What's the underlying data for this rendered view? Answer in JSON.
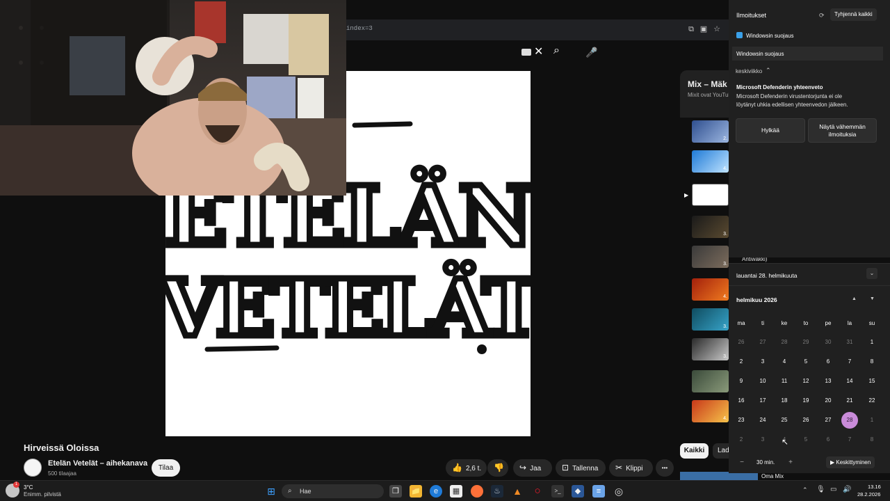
{
  "browser": {
    "url_fragment": "index=3"
  },
  "video": {
    "title": "Hirveissä Oloissa",
    "channel_name": "Etelän Vetelät – aihekanava",
    "subscribers": "500 tilaajaa",
    "subscribe_label": "Tilaa",
    "likes": "2,6 t.",
    "share_label": "Jaa",
    "save_label": "Tallenna",
    "clip_label": "Klippi",
    "more_label": "•••",
    "album_art_text_1": "ETELÄN",
    "album_art_text_2": "VETELÄT"
  },
  "mix": {
    "title": "Mix – Mäk",
    "subtitle": "Mixit ovat YouTub",
    "durations": [
      "2.",
      "4.",
      "3.",
      "3.",
      "4.",
      "3.",
      "3.",
      "4."
    ],
    "chip_all": "Kaikki",
    "chip_2": "Lad",
    "bottom_label": "Oma Mix",
    "antiwakki": "Antiwäkki)"
  },
  "notifications": {
    "header": "Ilmoitukset",
    "clear_all": "Tyhjennä kaikki",
    "app_name": "Windowsin suojaus",
    "group_label": "Windowsin suojaus",
    "day_label": "keskiviikko",
    "item_title": "Microsoft Defenderin yhteenveto",
    "item_body_1": "Microsoft Defenderin virustentorjunta ei ole",
    "item_body_2": "löytänyt uhkia edellisen yhteenvedon jälkeen.",
    "dismiss_label": "Hylkää",
    "show_less_label_1": "Näytä vähemmän",
    "show_less_label_2": "ilmoituksia"
  },
  "calendar": {
    "date_header": "lauantai 28. helmikuuta",
    "month_label": "helmikuu 2026",
    "day_names": [
      "ma",
      "ti",
      "ke",
      "to",
      "pe",
      "la",
      "su"
    ],
    "weeks": [
      [
        "26",
        "27",
        "28",
        "29",
        "30",
        "31",
        "1"
      ],
      [
        "2",
        "3",
        "4",
        "5",
        "6",
        "7",
        "8"
      ],
      [
        "9",
        "10",
        "11",
        "12",
        "13",
        "14",
        "15"
      ],
      [
        "16",
        "17",
        "18",
        "19",
        "20",
        "21",
        "22"
      ],
      [
        "23",
        "24",
        "25",
        "26",
        "27",
        "28",
        "1"
      ],
      [
        "2",
        "3",
        "4",
        "5",
        "6",
        "7",
        "8"
      ]
    ],
    "today": "28",
    "focus_minutes": "30 min.",
    "focus_label": "Keskittyminen"
  },
  "taskbar": {
    "weather_temp": "3°C",
    "weather_desc": "Enimm. pilvistä",
    "search_placeholder": "Hae",
    "time": "13.16",
    "date": "28.2.2026"
  },
  "colors": {
    "today_accent": "#c98bd9",
    "youtube_bg": "#0f0f0f",
    "panel_bg": "#202020"
  }
}
